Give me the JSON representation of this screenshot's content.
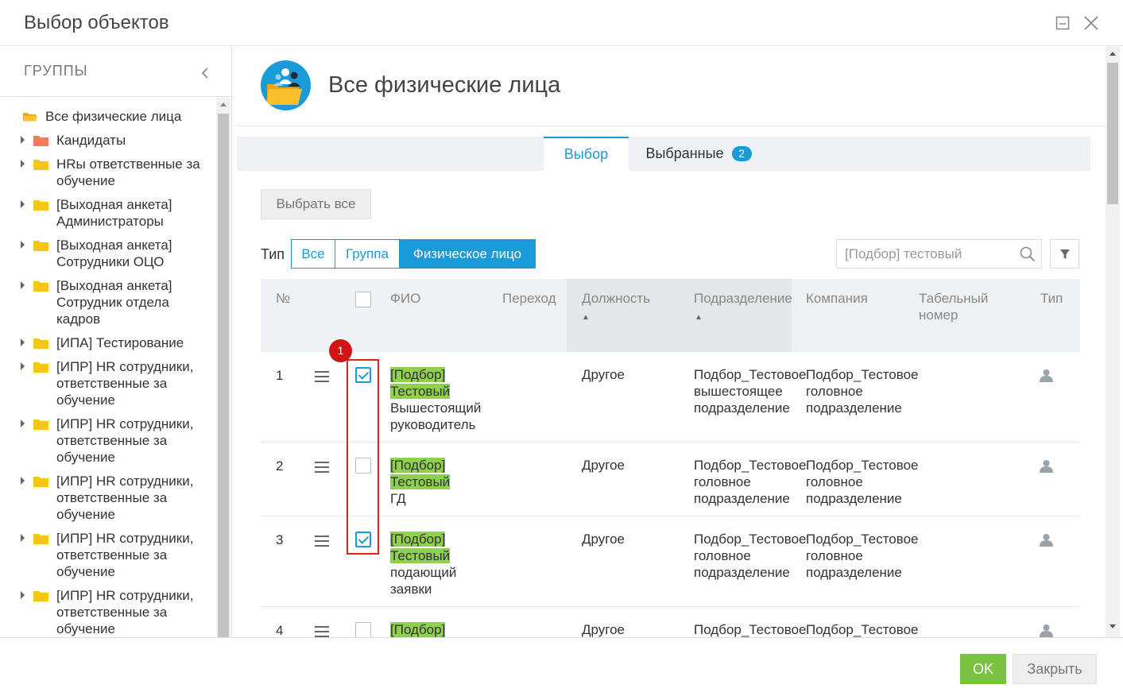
{
  "dialog": {
    "title": "Выбор объектов"
  },
  "left": {
    "title": "ГРУППЫ",
    "root": "Все физические лица",
    "items": [
      {
        "label": "Кандидаты",
        "color": "#f47c5a"
      },
      {
        "label": "HRы ответственные за обучение",
        "color": "#f5c518"
      },
      {
        "label": "[Выходная анкета] Администраторы",
        "color": "#f5c518"
      },
      {
        "label": "[Выходная анкета] Сотрудники ОЦО",
        "color": "#f5c518"
      },
      {
        "label": "[Выходная анкета] Сотрудник отдела кадров",
        "color": "#f5c518"
      },
      {
        "label": "[ИПА] Тестирование",
        "color": "#f5c518"
      },
      {
        "label": "[ИПР] HR сотрудники, ответственные за обучение",
        "color": "#f5c518"
      },
      {
        "label": "[ИПР] HR сотрудники, ответственные за обучение",
        "color": "#f5c518"
      },
      {
        "label": "[ИПР] HR сотрудники, ответственные за обучение",
        "color": "#f5c518"
      },
      {
        "label": "[ИПР] HR сотрудники, ответственные за обучение",
        "color": "#f5c518"
      },
      {
        "label": "[ИПР] HR сотрудники, ответственные за обучение",
        "color": "#f5c518"
      }
    ]
  },
  "main": {
    "title": "Все физические лица",
    "tabs": [
      {
        "label": "Выбор"
      },
      {
        "label": "Выбранные",
        "badge": "2"
      }
    ],
    "select_all": "Выбрать все",
    "type_label": "Тип",
    "type_options": [
      "Все",
      "Группа",
      "Физическое лицо"
    ],
    "type_selected": "Физическое лицо",
    "search": {
      "value": "",
      "placeholder": "[Подбор] тестовый"
    },
    "columns": {
      "num": "№",
      "fio": "ФИО",
      "transition": "Переход",
      "position": "Должность",
      "department": "Подразделение",
      "company": "Компания",
      "tab_no": "Табельный номер",
      "type": "Тип"
    },
    "rows": [
      {
        "num": "1",
        "checked": true,
        "fio_hl1": "[Подбор]",
        "fio_hl2": "Тестовый",
        "fio_rest": "Вышестоящий руководитель",
        "position": "Другое",
        "department": "Подбор_Тестовое вышестоящее подразделение",
        "company": "Подбор_Тестовое головное подразделение"
      },
      {
        "num": "2",
        "checked": false,
        "fio_hl1": "[Подбор]",
        "fio_hl2": "Тестовый",
        "fio_rest": "ГД",
        "position": "Другое",
        "department": "Подбор_Тестовое головное подразделение",
        "company": "Подбор_Тестовое головное подразделение"
      },
      {
        "num": "3",
        "checked": true,
        "fio_hl1": "[Подбор]",
        "fio_hl2": "Тестовый",
        "fio_rest": "подающий заявки",
        "position": "Другое",
        "department": "Подбор_Тестовое головное подразделение",
        "company": "Подбор_Тестовое головное подразделение"
      },
      {
        "num": "4",
        "checked": false,
        "fio_hl1": "[Подбор]",
        "fio_hl2": "",
        "fio_rest": "",
        "position": "Другое",
        "department": "Подбор_Тестовое",
        "company": "Подбор_Тестовое"
      }
    ],
    "annotation_badge": "1"
  },
  "footer": {
    "ok": "OK",
    "close": "Закрыть"
  },
  "colors": {
    "accent": "#1a9ad6",
    "ok_green": "#7cc242",
    "highlight": "#8fd14f",
    "annotation_red": "#e01f1f"
  }
}
